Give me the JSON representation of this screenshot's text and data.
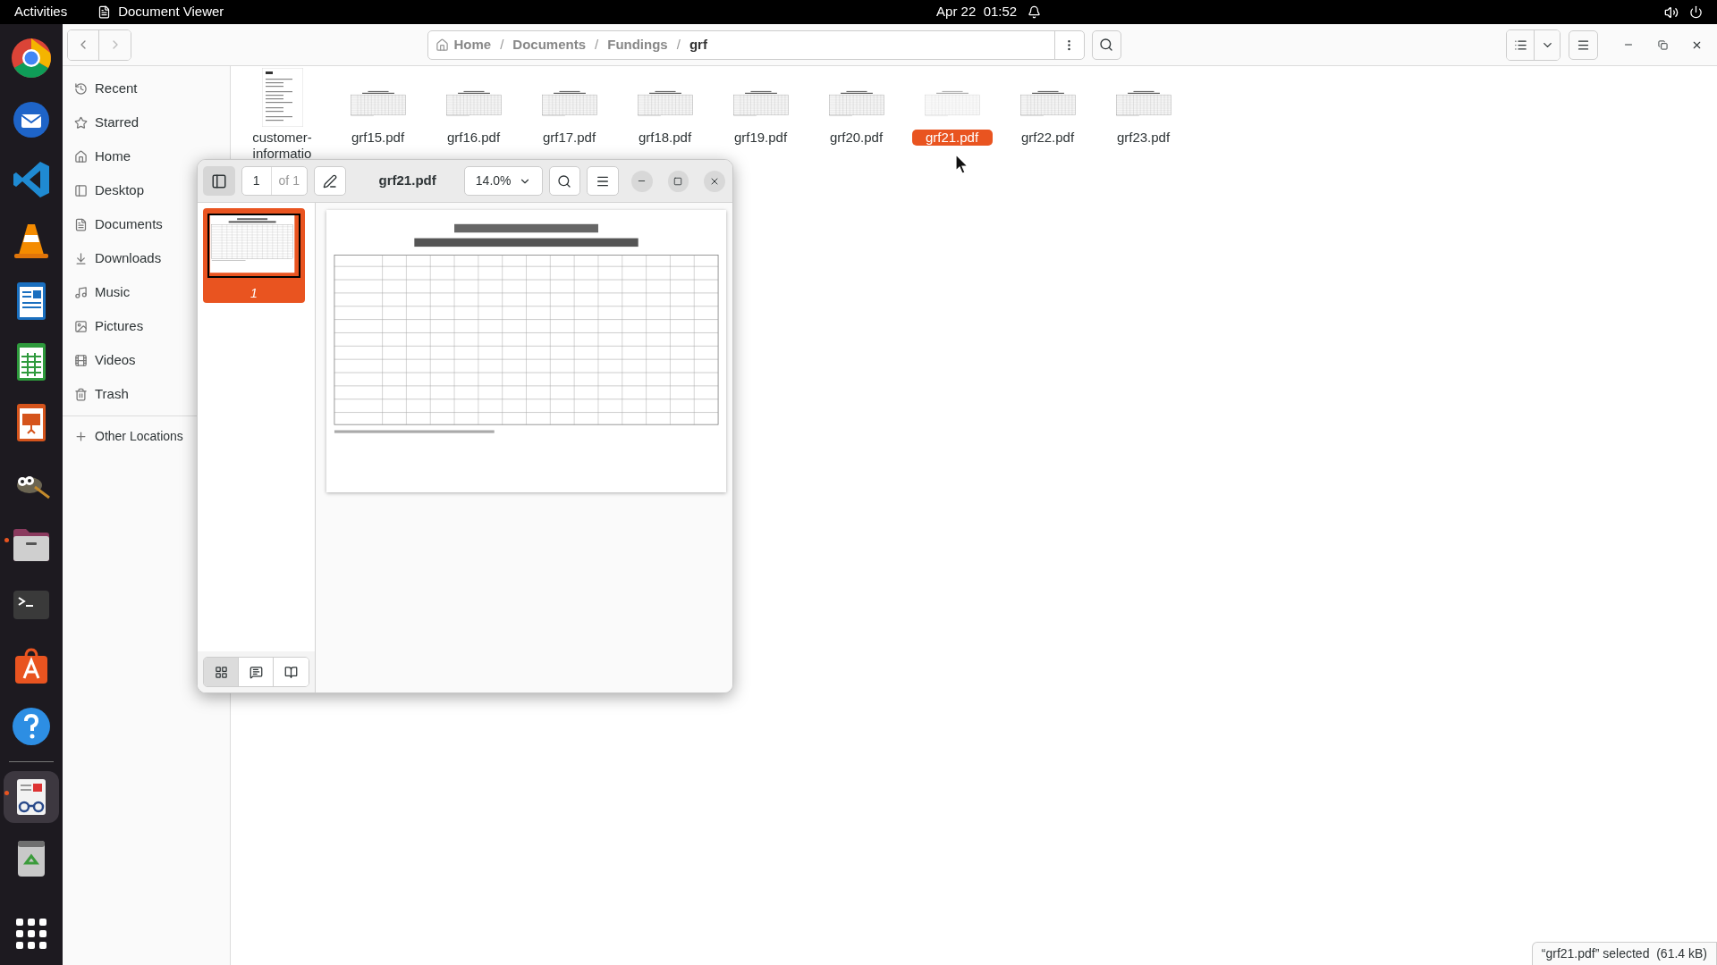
{
  "top_bar": {
    "activities": "Activities",
    "app_name": "Document Viewer",
    "clock": "Apr 22  01:52"
  },
  "dock": [
    {
      "kind": "browser",
      "running": false,
      "selected": false
    },
    {
      "kind": "mail",
      "running": false,
      "selected": false
    },
    {
      "kind": "editor",
      "running": false,
      "selected": false
    },
    {
      "kind": "media",
      "running": false,
      "selected": false
    },
    {
      "kind": "writer",
      "running": false,
      "selected": false
    },
    {
      "kind": "calc",
      "running": false,
      "selected": false
    },
    {
      "kind": "impress",
      "running": false,
      "selected": false
    },
    {
      "kind": "paint",
      "running": false,
      "selected": false
    },
    {
      "kind": "files",
      "running": true,
      "selected": false
    },
    {
      "kind": "terminal",
      "running": false,
      "selected": false
    },
    {
      "kind": "store",
      "running": false,
      "selected": false
    },
    {
      "kind": "help",
      "running": false,
      "selected": false
    },
    {
      "kind": "viewer",
      "running": true,
      "selected": true
    },
    {
      "kind": "trash",
      "running": false,
      "selected": false
    }
  ],
  "files_window": {
    "path": [
      {
        "label": "Home"
      },
      {
        "separator": "/",
        "label": "Documents"
      },
      {
        "separator": "/",
        "label": "Fundings"
      },
      {
        "separator": "/",
        "label": "grf"
      }
    ],
    "sidebar": {
      "items": [
        {
          "kind": "recent",
          "label": "Recent"
        },
        {
          "kind": "starred",
          "label": "Starred"
        },
        {
          "kind": "home",
          "label": "Home"
        },
        {
          "kind": "desktop",
          "label": "Desktop"
        },
        {
          "kind": "documents",
          "label": "Documents"
        },
        {
          "kind": "downloads",
          "label": "Downloads"
        },
        {
          "kind": "music",
          "label": "Music"
        },
        {
          "kind": "pictures",
          "label": "Pictures"
        },
        {
          "kind": "videos",
          "label": "Videos"
        },
        {
          "kind": "trash",
          "label": "Trash"
        }
      ],
      "other": "Other Locations"
    },
    "files": [
      {
        "name": "customer-informatio",
        "kind": "letter",
        "selected": false
      },
      {
        "name": "grf15.pdf",
        "kind": "table",
        "selected": false
      },
      {
        "name": "grf16.pdf",
        "kind": "table",
        "selected": false
      },
      {
        "name": "grf17.pdf",
        "kind": "table",
        "selected": false
      },
      {
        "name": "grf18.pdf",
        "kind": "table",
        "selected": false
      },
      {
        "name": "grf19.pdf",
        "kind": "table",
        "selected": false
      },
      {
        "name": "grf20.pdf",
        "kind": "table",
        "selected": false
      },
      {
        "name": "grf21.pdf",
        "kind": "table",
        "selected": true
      },
      {
        "name": "grf22.pdf",
        "kind": "table",
        "selected": false
      },
      {
        "name": "grf23.pdf",
        "kind": "table",
        "selected": false
      }
    ],
    "status": "“grf21.pdf” selected  (61.4 kB)"
  },
  "viewer_window": {
    "page": "1",
    "page_count": "of 1",
    "title": "grf21.pdf",
    "zoom": "14.0%",
    "thumbnails": [
      {
        "label": "1",
        "selected": true
      }
    ],
    "sidebar_modes": [
      {
        "kind": "thumbnails",
        "selected": true
      },
      {
        "kind": "annotations",
        "selected": false
      },
      {
        "kind": "bookmarks",
        "selected": false
      }
    ]
  }
}
